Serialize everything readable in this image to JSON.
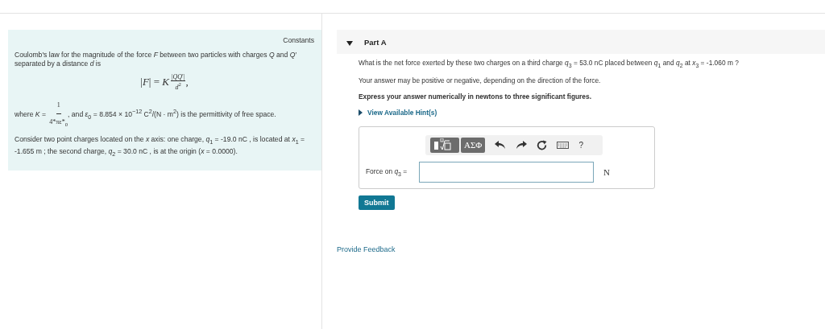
{
  "info_panel": {
    "constants_link": "Constants",
    "paragraphs": [
      {
        "kind": "text",
        "text": "Coulomb's law for the magnitude of the force *F* between two particles with charges *Q* and *Q*′ separated by a distance *d* is"
      },
      {
        "kind": "formula",
        "lhs": "|*F*| = *K*",
        "num": "|*QQ*′|",
        "den": "*d*$^{2}$",
        "after": ","
      },
      {
        "kind": "fraction_text",
        "before": "where *K* = ",
        "num": "1",
        "den": "4*πε*$_{0}$",
        "after": ", and *ε*$_{0}$ = 8.854 × 10$^{−12}$ C$^{2}$/(N · m$^{2}$) is the permittivity of free space."
      },
      {
        "kind": "text",
        "text": "Consider two point charges located on the *x* axis: one charge, *q*$_{1}$ = -19.0 nC , is located at *x*$_{1}$ = -1.655 m ; the second charge, *q*$_{2}$ = 30.0 nC , is at the origin (*x* = 0.0000)."
      }
    ]
  },
  "part": {
    "title": "Part A",
    "expanded": true,
    "question": "What is the net force exerted by these two charges on a third charge *q*$_{3}$ = 53.0 nC placed between *q*$_{1}$ and *q*$_{2}$ at *x*$_{3}$ = -1.060 m ?",
    "note": "Your answer may be positive or negative, depending on the direction of the force.",
    "instruction": "Express your answer numerically in newtons to three significant figures.",
    "hints_link": "View Available Hint(s)",
    "toolbar": [
      {
        "kind": "templates"
      },
      {
        "kind": "greek",
        "label": "ΑΣΦ"
      },
      {
        "kind": "undo"
      },
      {
        "kind": "redo"
      },
      {
        "kind": "reset"
      },
      {
        "kind": "keyboard"
      },
      {
        "kind": "help",
        "label": "?"
      }
    ],
    "answer_label": "Force on *q*$_{3}$ =",
    "unit": "N",
    "submit": "Submit"
  },
  "feedback_link": "Provide Feedback"
}
